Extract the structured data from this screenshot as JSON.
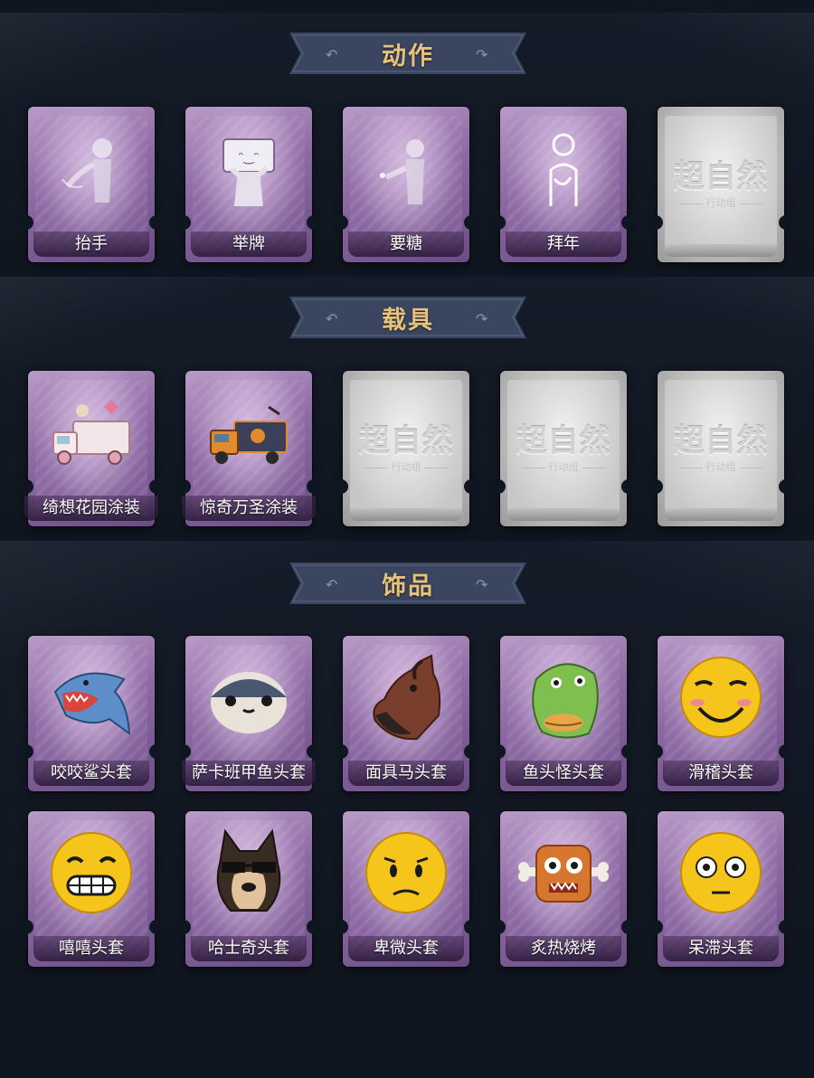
{
  "colors": {
    "background": "#0f1521",
    "banner_bg": "#3a4560",
    "title_gold": "#e8c27a",
    "card_purple": "#8d6aa3",
    "card_grey": "#bcbcbc"
  },
  "sections": [
    {
      "title": "动作",
      "items": [
        {
          "label": "抬手",
          "icon": "raise-hand-pose-icon",
          "style": "purple"
        },
        {
          "label": "举牌",
          "icon": "hold-sign-pose-icon",
          "style": "purple"
        },
        {
          "label": "要糖",
          "icon": "ask-candy-pose-icon",
          "style": "purple"
        },
        {
          "label": "拜年",
          "icon": "new-year-greeting-pose-icon",
          "style": "purple"
        },
        {
          "label": "",
          "icon": "placeholder-logo-icon",
          "style": "grey"
        }
      ]
    },
    {
      "title": "载具",
      "items": [
        {
          "label": "绮想花园涂装",
          "icon": "garden-truck-icon",
          "style": "purple"
        },
        {
          "label": "惊奇万圣涂装",
          "icon": "halloween-truck-icon",
          "style": "purple"
        },
        {
          "label": "",
          "icon": "placeholder-logo-icon",
          "style": "grey"
        },
        {
          "label": "",
          "icon": "placeholder-logo-icon",
          "style": "grey"
        },
        {
          "label": "",
          "icon": "placeholder-logo-icon",
          "style": "grey"
        }
      ]
    },
    {
      "title": "饰品",
      "items": [
        {
          "label": "咬咬鲨头套",
          "icon": "shark-mask-icon",
          "style": "purple"
        },
        {
          "label": "萨卡班甲鱼头套",
          "icon": "sacabambaspis-mask-icon",
          "style": "purple"
        },
        {
          "label": "面具马头套",
          "icon": "horse-mask-icon",
          "style": "purple"
        },
        {
          "label": "鱼头怪头套",
          "icon": "fish-head-mask-icon",
          "style": "purple"
        },
        {
          "label": "滑稽头套",
          "icon": "funny-face-mask-icon",
          "style": "purple"
        },
        {
          "label": "嘻嘻头套",
          "icon": "grin-face-mask-icon",
          "style": "purple"
        },
        {
          "label": "哈士奇头套",
          "icon": "husky-mask-icon",
          "style": "purple"
        },
        {
          "label": "卑微头套",
          "icon": "humble-face-mask-icon",
          "style": "purple"
        },
        {
          "label": "炙热烧烤",
          "icon": "bbq-meat-mask-icon",
          "style": "purple"
        },
        {
          "label": "呆滞头套",
          "icon": "dazed-face-mask-icon",
          "style": "purple"
        }
      ]
    }
  ],
  "placeholder": {
    "logo_text": "超自然",
    "sub_text": "行动组"
  }
}
